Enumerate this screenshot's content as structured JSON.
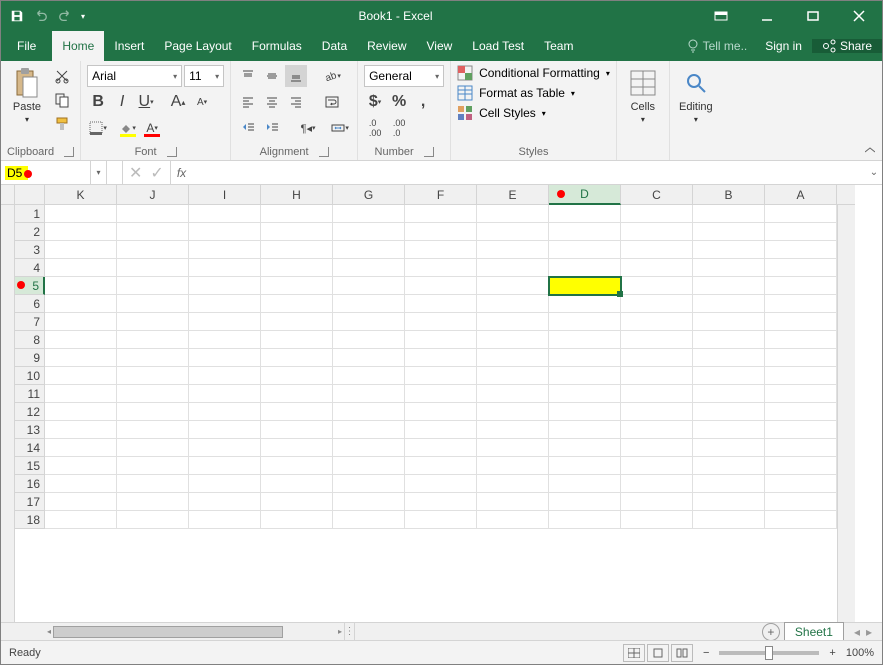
{
  "app": {
    "title": "Book1 - Excel"
  },
  "qat": {
    "save": "save",
    "undo": "undo",
    "redo": "redo"
  },
  "tabs": {
    "file": "File",
    "home": "Home",
    "insert": "Insert",
    "page_layout": "Page Layout",
    "formulas": "Formulas",
    "data": "Data",
    "review": "Review",
    "view": "View",
    "load_test": "Load Test",
    "team": "Team"
  },
  "tell_me": "Tell me..",
  "signin": "Sign in",
  "share": "Share",
  "ribbon": {
    "clipboard": {
      "label": "Clipboard",
      "paste": "Paste"
    },
    "font": {
      "label": "Font",
      "name": "Arial",
      "size": "11"
    },
    "alignment": {
      "label": "Alignment"
    },
    "number": {
      "label": "Number",
      "format": "General"
    },
    "styles": {
      "label": "Styles",
      "conditional": "Conditional Formatting",
      "table": "Format as Table",
      "cell_styles": "Cell Styles"
    },
    "cells": {
      "label": "Cells"
    },
    "editing": {
      "label": "Editing"
    }
  },
  "name_box": "D5",
  "fx": "fx",
  "columns": [
    "K",
    "J",
    "I",
    "H",
    "G",
    "F",
    "E",
    "D",
    "C",
    "B",
    "A"
  ],
  "rows": [
    1,
    2,
    3,
    4,
    5,
    6,
    7,
    8,
    9,
    10,
    11,
    12,
    13,
    14,
    15,
    16,
    17,
    18
  ],
  "active_col": "D",
  "active_row": 5,
  "sheet_tab": "Sheet1",
  "status": "Ready",
  "zoom": "100%",
  "colors": {
    "accent": "#217346",
    "highlight": "#ffff00",
    "dot": "#ff0000"
  }
}
